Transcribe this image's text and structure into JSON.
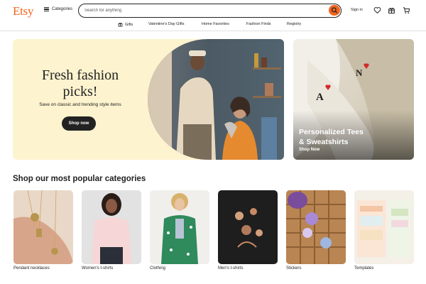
{
  "header": {
    "logo": "Etsy",
    "categories_label": "Categories",
    "search_placeholder": "Search for anything",
    "signin_label": "Sign in",
    "icons": [
      "search-icon",
      "heart-icon",
      "gift-icon",
      "cart-icon"
    ]
  },
  "subnav": {
    "items": [
      "Gifts",
      "Valentine's Day Gifts",
      "Home Favorites",
      "Fashion Finds",
      "Registry"
    ]
  },
  "hero": {
    "title_line1": "Fresh fashion",
    "title_line2": "picks!",
    "subtitle": "Save on classic and trending style items",
    "button": "Shop now"
  },
  "promo": {
    "title_line1": "Personalized Tees",
    "title_line2": "& Sweatshirts",
    "link": "Shop Now"
  },
  "popular": {
    "title": "Shop our most popular categories",
    "items": [
      {
        "label": "Pendant necklaces"
      },
      {
        "label": "Women's t-shirts"
      },
      {
        "label": "Clothing"
      },
      {
        "label": "Men's t-shirts"
      },
      {
        "label": "Stickers"
      },
      {
        "label": "Templates"
      }
    ]
  },
  "colors": {
    "brand": "#f1641e",
    "hero_bg": "#fdf3cf",
    "text": "#222222"
  }
}
